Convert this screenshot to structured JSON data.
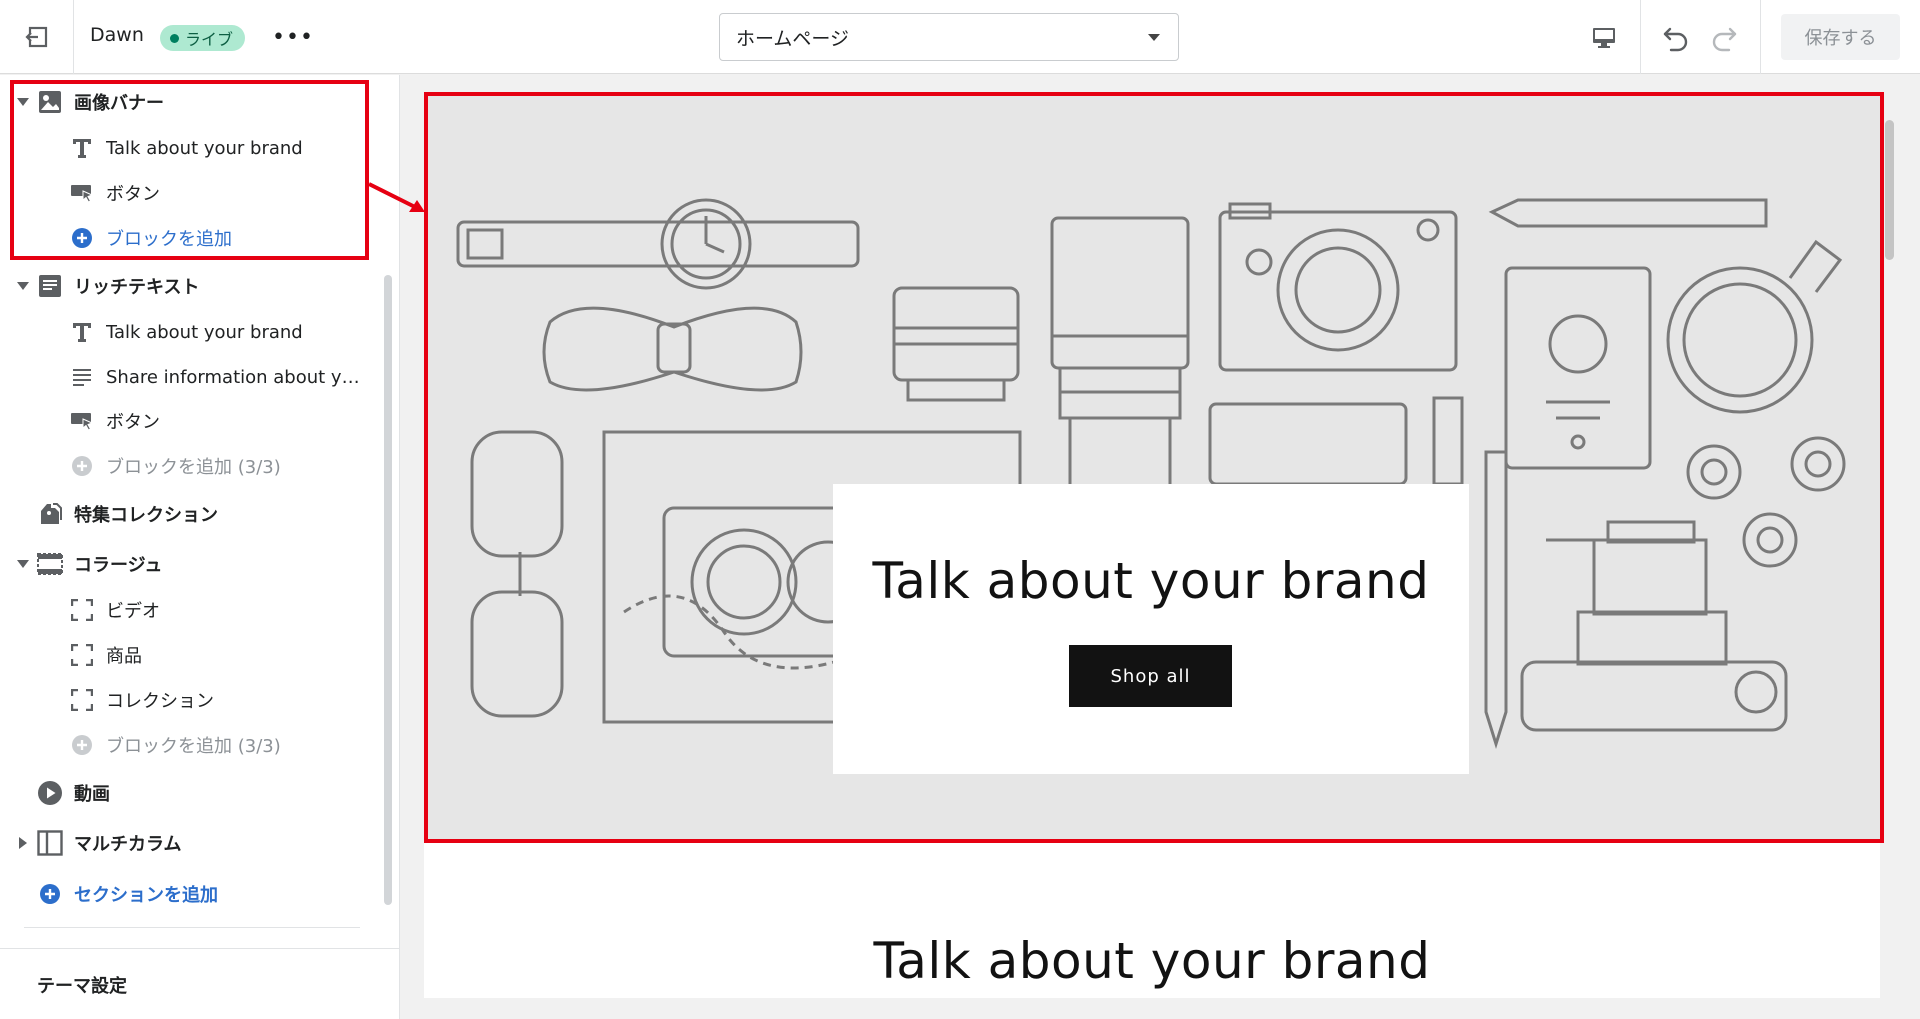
{
  "topbar": {
    "theme_name": "Dawn",
    "live_badge": "ライブ",
    "more_label": "•••",
    "page_select": "ホームページ",
    "save_label": "保存する"
  },
  "sidebar": {
    "sections": [
      {
        "label": "画像バナー",
        "icon": "image-icon",
        "expanded": true
      },
      {
        "label": "リッチテキスト",
        "icon": "text-block-icon",
        "expanded": true
      },
      {
        "label": "特集コレクション",
        "icon": "collection-tag-icon",
        "expanded": false
      },
      {
        "label": "コラージュ",
        "icon": "collage-icon",
        "expanded": true
      },
      {
        "label": "動画",
        "icon": "play-icon",
        "expanded": false
      },
      {
        "label": "マルチカラム",
        "icon": "columns-icon",
        "expanded": false
      }
    ],
    "banner_blocks": [
      "Talk about your brand",
      "ボタン",
      "ブロックを追加"
    ],
    "richtext_blocks": [
      "Talk about your brand",
      "Share information about you...",
      "ボタン",
      "ブロックを追加 (3/3)"
    ],
    "collage_blocks": [
      "ビデオ",
      "商品",
      "コレクション",
      "ブロックを追加 (3/3)"
    ],
    "add_section": "セクションを追加",
    "theme_settings": "テーマ設定"
  },
  "preview": {
    "banner_heading": "Talk about your brand",
    "banner_button": "Shop all",
    "richtext_heading": "Talk about your brand"
  },
  "colors": {
    "highlight": "#e60012",
    "link_blue": "#2c6ecb",
    "live_badge_bg": "#aee9d1",
    "button_dark": "#121212",
    "banner_bg": "#e6e6e6"
  }
}
